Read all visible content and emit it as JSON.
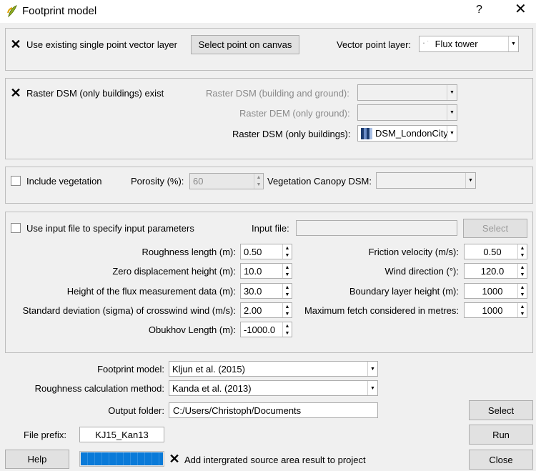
{
  "window": {
    "title": "Footprint model",
    "help": "?",
    "close": "✕"
  },
  "point_section": {
    "use_existing_label": "Use existing single point vector layer",
    "use_existing_checked": true,
    "select_point_button": "Select point on canvas",
    "vector_layer_label": "Vector point layer:",
    "vector_layer_value": "Flux tower"
  },
  "dsm_section": {
    "raster_exist_label": "Raster DSM (only buildings) exist",
    "raster_exist_checked": true,
    "dsm_bg_label": "Raster DSM (building and ground):",
    "dsm_bg_value": "",
    "dem_label": "Raster DEM (only ground):",
    "dem_value": "",
    "dsm_buildings_label": "Raster DSM (only buildings):",
    "dsm_buildings_value": "DSM_LondonCity"
  },
  "veg_section": {
    "include_label": "Include vegetation",
    "include_checked": false,
    "porosity_label": "Porosity (%):",
    "porosity_value": "60",
    "canopy_label": "Vegetation Canopy DSM:",
    "canopy_value": ""
  },
  "params_section": {
    "input_file_check_label": "Use input file to specify input parameters",
    "input_file_label": "Input file:",
    "input_file_value": "",
    "select_button": "Select",
    "left": [
      {
        "label": "Roughness length (m):",
        "value": "0.50"
      },
      {
        "label": "Zero displacement height (m):",
        "value": "10.0"
      },
      {
        "label": "Height of the flux measurement data (m):",
        "value": "30.0"
      },
      {
        "label": "Standard deviation (sigma) of crosswind wind (m/s):",
        "value": "2.00"
      },
      {
        "label": "Obukhov Length (m):",
        "value": "-1000.0"
      }
    ],
    "right": [
      {
        "label": "Friction velocity (m/s):",
        "value": "0.50"
      },
      {
        "label": "Wind direction (°):",
        "value": "120.0"
      },
      {
        "label": "Boundary layer height (m):",
        "value": "1000"
      },
      {
        "label": "Maximum fetch considered in metres:",
        "value": "1000"
      }
    ]
  },
  "bottom": {
    "footprint_model_label": "Footprint model:",
    "footprint_model_value": "Kljun et al. (2015)",
    "roughness_method_label": "Roughness calculation method:",
    "roughness_method_value": "Kanda et al. (2013)",
    "output_folder_label": "Output folder:",
    "output_folder_value": "C:/Users/Christoph/Documents",
    "select_button": "Select",
    "file_prefix_label": "File prefix:",
    "file_prefix_value": "KJ15_Kan13",
    "run_button": "Run",
    "help_button": "Help",
    "progress": 1.0,
    "add_result_label": "Add intergrated source area result to project",
    "add_result_checked": true,
    "close_button": "Close"
  },
  "colors": {
    "progress": "#0a7ad8",
    "window_bg": "#f0f0f0",
    "title_bg": "#ffffff"
  }
}
